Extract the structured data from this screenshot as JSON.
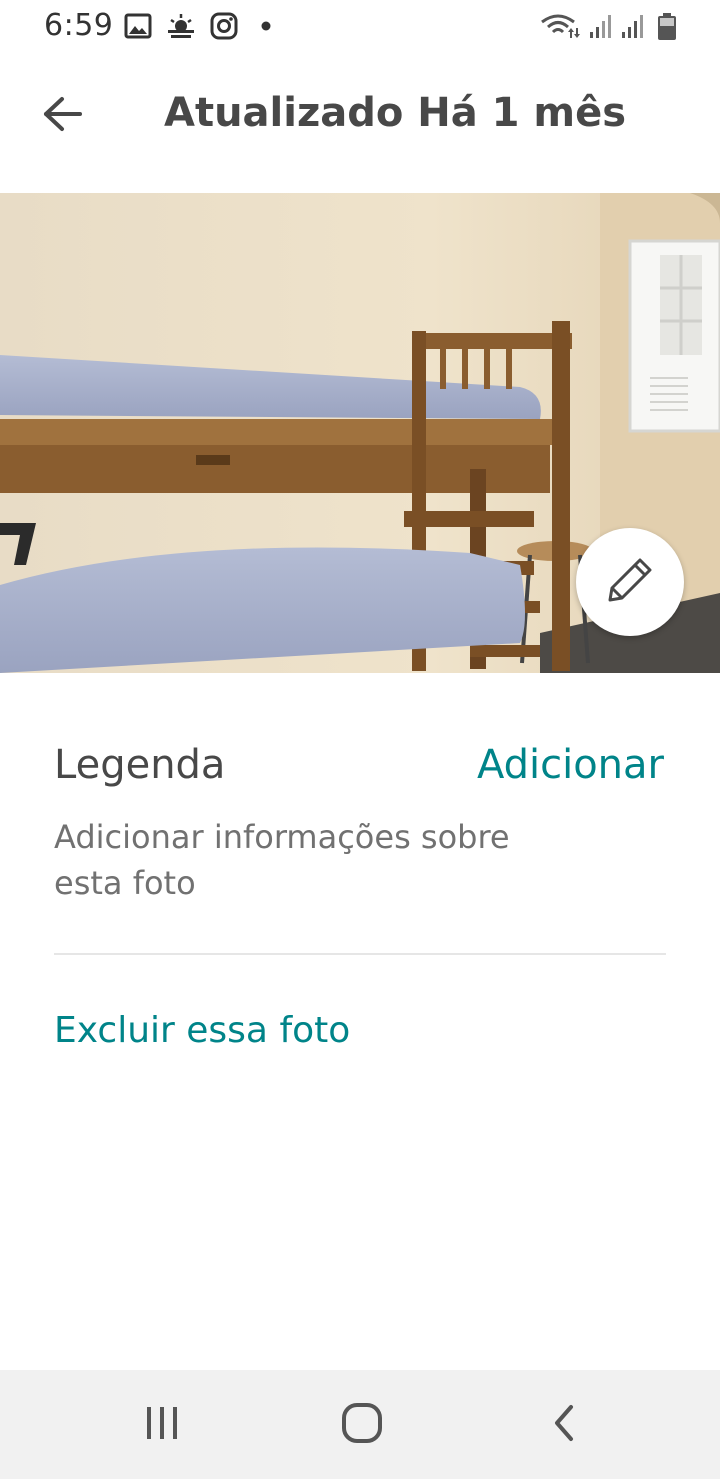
{
  "status_bar": {
    "time": "6:59",
    "left_icons": [
      "gallery-icon",
      "weather-icon",
      "instagram-icon",
      "dot-icon"
    ],
    "right_icons": [
      "wifi-icon",
      "signal-icon",
      "signal-icon",
      "battery-icon"
    ]
  },
  "header": {
    "back_icon": "arrow-left-icon",
    "title": "Atualizado Há 1 mês"
  },
  "photo": {
    "description_icon": "bunk-bed-photo",
    "edit_icon": "pencil-icon"
  },
  "caption": {
    "label": "Legenda",
    "add_label": "Adicionar",
    "help_text": "Adicionar informações sobre esta foto"
  },
  "actions": {
    "delete_label": "Excluir essa foto"
  },
  "nav_bar": {
    "icons": [
      "recent-apps-icon",
      "home-icon",
      "back-icon"
    ]
  },
  "colors": {
    "accent": "#008489",
    "text_primary": "#484848",
    "text_secondary": "#717171"
  }
}
